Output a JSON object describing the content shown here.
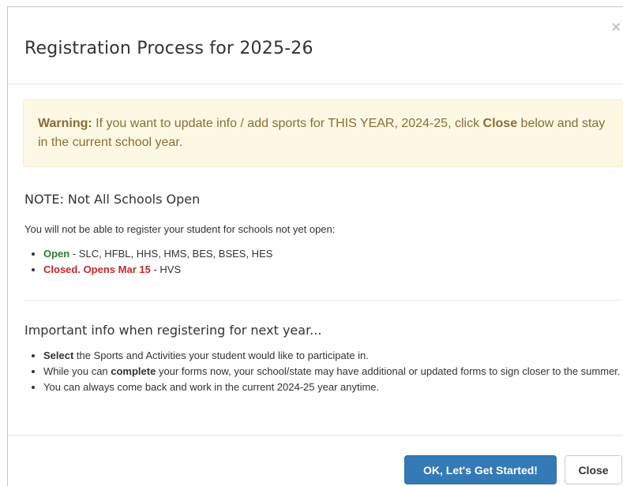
{
  "modal": {
    "title": "Registration Process for 2025-26",
    "close_icon": "×"
  },
  "warning": {
    "label": "Warning:",
    "text_part1": " If you want to update info / add sports for THIS YEAR, 2024-25, click ",
    "close_word": "Close",
    "text_part2": " below and stay in the current school year."
  },
  "note": {
    "heading": "NOTE: Not All Schools Open",
    "description": "You will not be able to register your student for schools not yet open:",
    "items": [
      {
        "status": "Open",
        "schools": " - SLC, HFBL, HHS, HMS, BES, BSES, HES"
      },
      {
        "status": "Closed. Opens Mar 15",
        "schools": " - HVS"
      }
    ]
  },
  "important": {
    "heading": "Important info when registering for next year...",
    "items": [
      {
        "bold": "Select",
        "text": " the Sports and Activities your student would like to participate in."
      },
      {
        "pre": "While you can ",
        "bold": "complete",
        "text": " your forms now, your school/state may have additional or updated forms to sign closer to the summer."
      },
      {
        "text": "You can always come back and work in the current 2024-25 year anytime."
      }
    ]
  },
  "footer": {
    "primary_label": "OK, Let's Get Started!",
    "close_label": "Close"
  },
  "colors": {
    "primary": "#337ab7",
    "warning_bg": "#fcf8e3",
    "warning_text": "#8a6d3b",
    "open": "#2e7d32",
    "closed": "#c62828"
  }
}
